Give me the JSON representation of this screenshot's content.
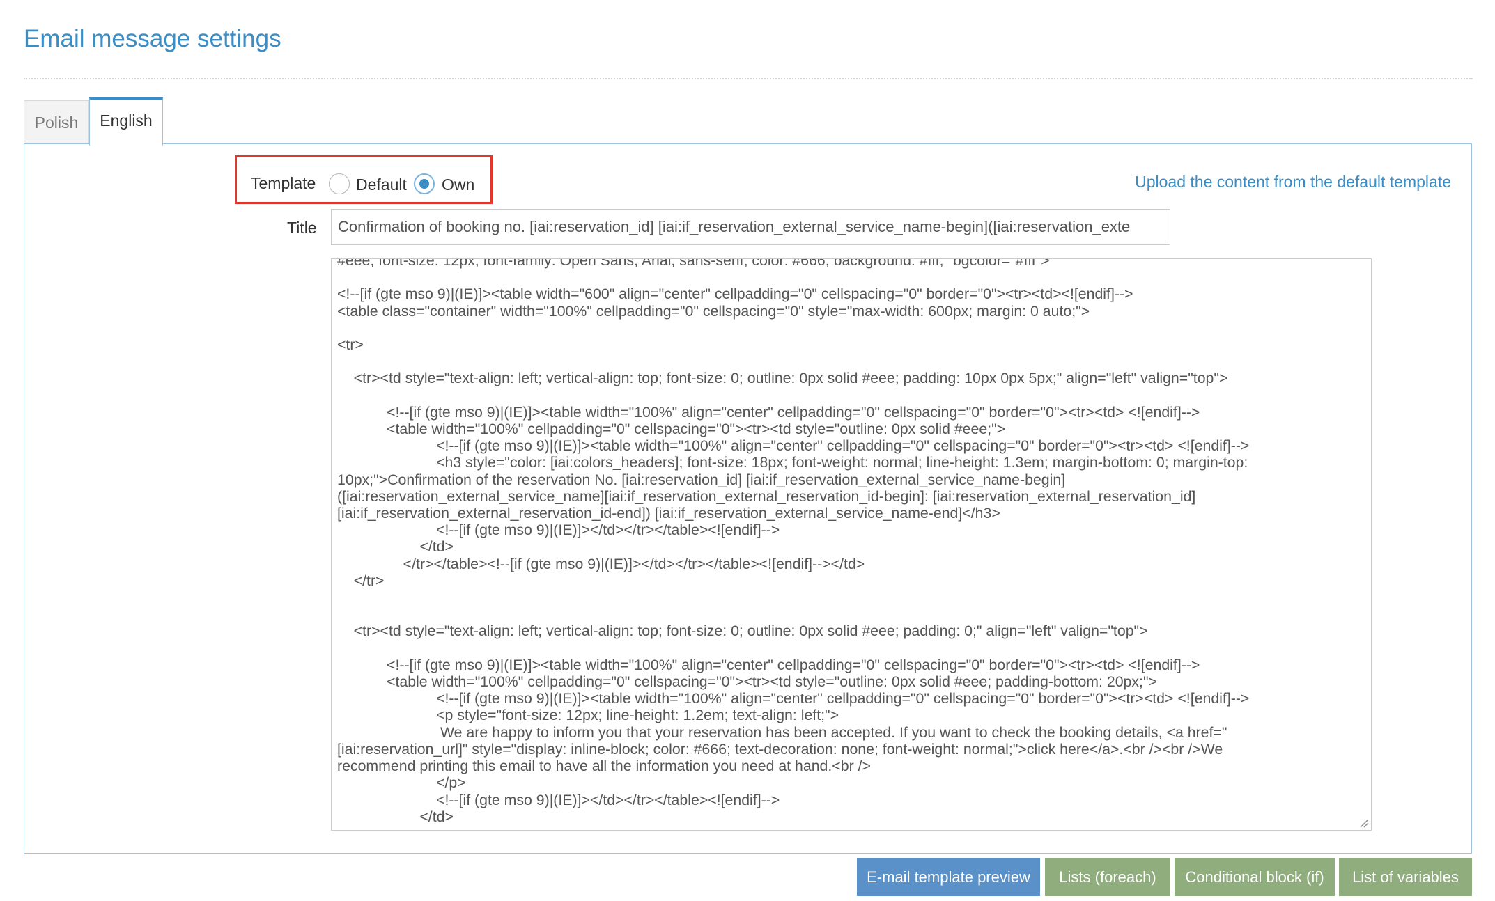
{
  "page": {
    "title": "Email message settings"
  },
  "tabs": [
    {
      "label": "Polish",
      "active": false
    },
    {
      "label": "English",
      "active": true
    }
  ],
  "template": {
    "label": "Template",
    "options": [
      {
        "label": "Default",
        "selected": false
      },
      {
        "label": "Own",
        "selected": true
      }
    ],
    "highlight_color": "#e2382b"
  },
  "upload_link": "Upload the content from the default template",
  "title_field": {
    "label": "Title",
    "value": "Confirmation of booking no. [iai:reservation_id] [iai:if_reservation_external_service_name-begin]([iai:reservation_exte"
  },
  "body_field": {
    "content": "#eee; font-size: 12px; font-family: Open Sans, Arial, sans-serif; color: #666; background: #fff;\" bgcolor=\"#fff\">\n\n<!--[if (gte mso 9)|(IE)]><table width=\"600\" align=\"center\" cellpadding=\"0\" cellspacing=\"0\" border=\"0\"><tr><td><![endif]-->\n<table class=\"container\" width=\"100%\" cellpadding=\"0\" cellspacing=\"0\" style=\"max-width: 600px; margin: 0 auto;\">\n\n<tr>\n\n    <tr><td style=\"text-align: left; vertical-align: top; font-size: 0; outline: 0px solid #eee; padding: 10px 0px 5px;\" align=\"left\" valign=\"top\">\n\n            <!--[if (gte mso 9)|(IE)]><table width=\"100%\" align=\"center\" cellpadding=\"0\" cellspacing=\"0\" border=\"0\"><tr><td> <![endif]-->\n            <table width=\"100%\" cellpadding=\"0\" cellspacing=\"0\"><tr><td style=\"outline: 0px solid #eee;\">\n                        <!--[if (gte mso 9)|(IE)]><table width=\"100%\" align=\"center\" cellpadding=\"0\" cellspacing=\"0\" border=\"0\"><tr><td> <![endif]-->\n                        <h3 style=\"color: [iai:colors_headers]; font-size: 18px; font-weight: normal; line-height: 1.3em; margin-bottom: 0; margin-top:\n10px;\">Confirmation of the reservation No. [iai:reservation_id] [iai:if_reservation_external_service_name-begin]\n([iai:reservation_external_service_name][iai:if_reservation_external_reservation_id-begin]: [iai:reservation_external_reservation_id]\n[iai:if_reservation_external_reservation_id-end]) [iai:if_reservation_external_service_name-end]</h3>\n                        <!--[if (gte mso 9)|(IE)]></td></tr></table><![endif]-->\n                    </td>\n                </tr></table><!--[if (gte mso 9)|(IE)]></td></tr></table><![endif]--></td>\n    </tr>\n\n\n    <tr><td style=\"text-align: left; vertical-align: top; font-size: 0; outline: 0px solid #eee; padding: 0;\" align=\"left\" valign=\"top\">\n\n            <!--[if (gte mso 9)|(IE)]><table width=\"100%\" align=\"center\" cellpadding=\"0\" cellspacing=\"0\" border=\"0\"><tr><td> <![endif]-->\n            <table width=\"100%\" cellpadding=\"0\" cellspacing=\"0\"><tr><td style=\"outline: 0px solid #eee; padding-bottom: 20px;\">\n                        <!--[if (gte mso 9)|(IE)]><table width=\"100%\" align=\"center\" cellpadding=\"0\" cellspacing=\"0\" border=\"0\"><tr><td> <![endif]-->\n                        <p style=\"font-size: 12px; line-height: 1.2em; text-align: left;\">\n                         We are happy to inform you that your reservation has been accepted. If you want to check the booking details, <a href=\"\n[iai:reservation_url]\" style=\"display: inline-block; color: #666; text-decoration: none; font-weight: normal;\">click here</a>.<br /><br />We\nrecommend printing this email to have all the information you need at hand.<br />\n                        </p>\n                        <!--[if (gte mso 9)|(IE)]></td></tr></table><![endif]-->\n                    </td>"
  },
  "buttons": {
    "preview": "E-mail template preview",
    "lists": "Lists (foreach)",
    "conditional": "Conditional block (if)",
    "variables": "List of variables"
  },
  "colors": {
    "accent": "#3a8dc5",
    "primary_button": "#5b91c9",
    "secondary_button": "#8fad7d"
  }
}
